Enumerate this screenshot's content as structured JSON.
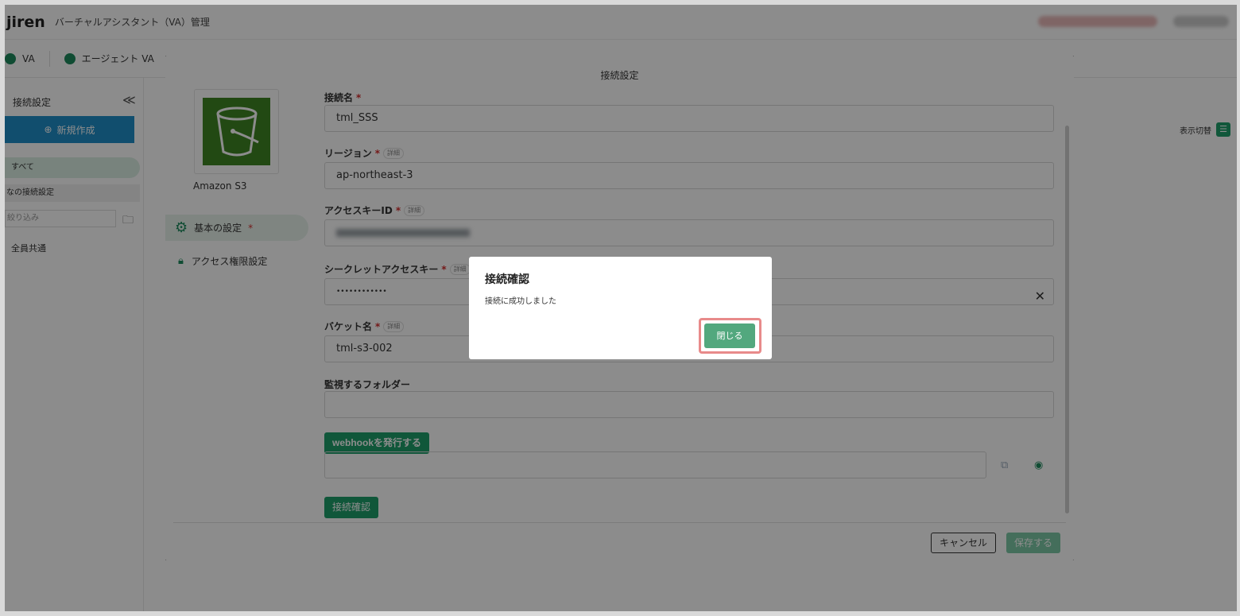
{
  "app": {
    "logo": "jiren",
    "title": "バーチャルアシスタント（VA）管理"
  },
  "nav": {
    "items": [
      {
        "label": "VA",
        "icon": "va-icon"
      },
      {
        "label": "エージェント VA",
        "icon": "agent-icon"
      }
    ]
  },
  "sidebar": {
    "title": "接続設定",
    "collapse_icon": "≪",
    "new_button": "新規作成",
    "all_label": "すべて",
    "group_label": "なの接続設定",
    "filter_placeholder": "絞り込み",
    "common_label": "全員共通"
  },
  "main": {
    "view_toggle_label": "表示切替"
  },
  "modal": {
    "title": "接続設定",
    "service_name": "Amazon S3",
    "menu": {
      "basic": "基本の設定",
      "access": "アクセス権限設定"
    },
    "fields": {
      "connection_name_label": "接続名",
      "connection_name_value": "tml_SSS",
      "region_label": "リージョン",
      "region_value": "ap-northeast-3",
      "access_key_label": "アクセスキーID",
      "secret_key_label": "シークレットアクセスキー",
      "secret_key_value": "••••••••••••",
      "bucket_label": "バケット名",
      "bucket_value": "tml-s3-002",
      "folder_label": "監視するフォルダー",
      "detail_tag": "詳細",
      "required_mark": "*"
    },
    "webhook_button": "webhookを発行する",
    "test_button": "接続確認",
    "cancel_button": "キャンセル",
    "save_button": "保存する"
  },
  "dialog": {
    "title": "接続確認",
    "message": "接続に成功しました",
    "close_button": "閉じる"
  },
  "colors": {
    "accent": "#1e9e6b",
    "highlight": "#e88a8a",
    "s3": "#3f8624"
  }
}
